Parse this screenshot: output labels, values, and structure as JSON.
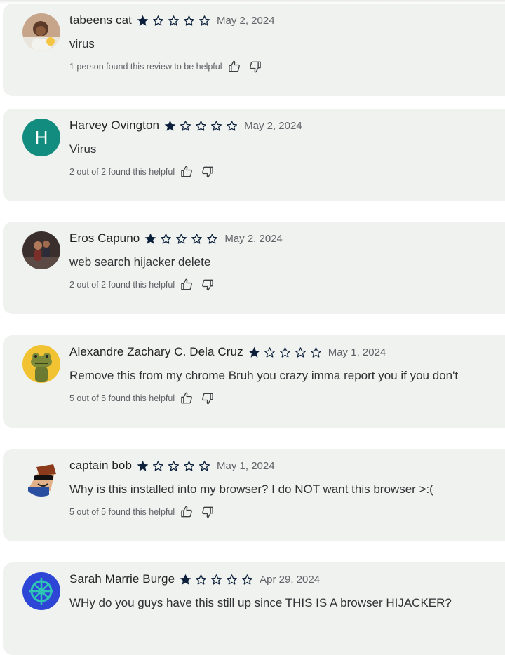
{
  "reviews": [
    {
      "name": "tabeens cat",
      "rating": 1,
      "date": "May 2, 2024",
      "text": "virus",
      "helpful": "1 person found this review to be helpful",
      "avatar": "photo-person-avatar"
    },
    {
      "name": "Harvey Ovington",
      "rating": 1,
      "date": "May 2, 2024",
      "text": "Virus",
      "helpful": "2 out of 2 found this helpful",
      "avatar": "letter-avatar",
      "avatar_letter": "H",
      "avatar_color": "#128c7e"
    },
    {
      "name": "Eros Capuno",
      "rating": 1,
      "date": "May 2, 2024",
      "text": "web search hijacker delete",
      "helpful": "2 out of 2 found this helpful",
      "avatar": "photo-dark-avatar"
    },
    {
      "name": "Alexandre Zachary C. Dela Cruz",
      "rating": 1,
      "date": "May 1, 2024",
      "text": "Remove this from my chrome Bruh you crazy imma report you if you don't",
      "helpful": "5 out of 5 found this helpful",
      "avatar": "frog-avatar"
    },
    {
      "name": "captain bob",
      "rating": 1,
      "date": "May 1, 2024",
      "text": "Why is this installed into my browser? I do NOT want this browser >:(",
      "helpful": "5 out of 5 found this helpful",
      "avatar": "roblox-avatar"
    },
    {
      "name": "Sarah Marrie Burge",
      "rating": 1,
      "date": "Apr 29, 2024",
      "text": "WHy do you guys have this still up since THIS IS A browser HIJACKER?",
      "helpful": "",
      "avatar": "emblem-avatar"
    }
  ],
  "max_rating": 5,
  "colors": {
    "card_bg": "#f0f2ef",
    "star": "#0b1f3a",
    "text": "#303134",
    "muted": "#5f6368"
  }
}
